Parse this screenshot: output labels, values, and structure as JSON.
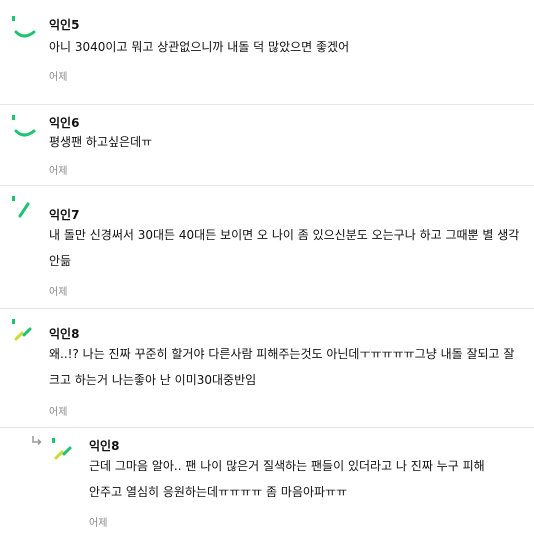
{
  "comments": [
    {
      "author": "익인5",
      "text": "아니 3040이고 뭐고 상관없으니까 내돌 덕 많았으면 좋겠어",
      "time": "어제",
      "avatar": "green-arc-icon"
    },
    {
      "author": "익인6",
      "text": "평생팬 하고싶은데ㅠ",
      "time": "어제",
      "avatar": "green-arc-icon"
    },
    {
      "author": "익인7",
      "text_lines": [
        "내 돌만 신경써서 30대든 40대든 보이면 오 나이 좀 있으신분도 오는구나 하고 그때뿐 별 생각",
        "안듦"
      ],
      "time": "어제",
      "avatar": "green-slash-icon"
    },
    {
      "author": "익인8",
      "text_lines": [
        "왜..!? 나는 진짜 꾸준히 할거야 다른사람 피해주는것도 아닌데ㅜㅠㅠㅠㅠ그냥 내돌 잘되고 잘",
        "크고 하는거 나는좋아 난 이미30대중반임"
      ],
      "time": "어제",
      "avatar": "yellow-green-dashes-icon"
    }
  ],
  "reply": {
    "author": "익인8",
    "text_lines": [
      "근데 그마음 알아.. 팬 나이 많은거 질색하는 팬들이 있더라고 나 진짜 누구 피해",
      "안주고 열심히 응원하는데ㅠㅠㅠㅠ 좀 마음아파ㅠㅠ"
    ],
    "time": "어제",
    "avatar": "yellow-green-dashes-icon"
  },
  "colors": {
    "accent_green": "#1ec36f",
    "accent_yellow": "#c8dc33",
    "divider": "#e6e6e6",
    "meta_text": "#8a8a8a"
  }
}
